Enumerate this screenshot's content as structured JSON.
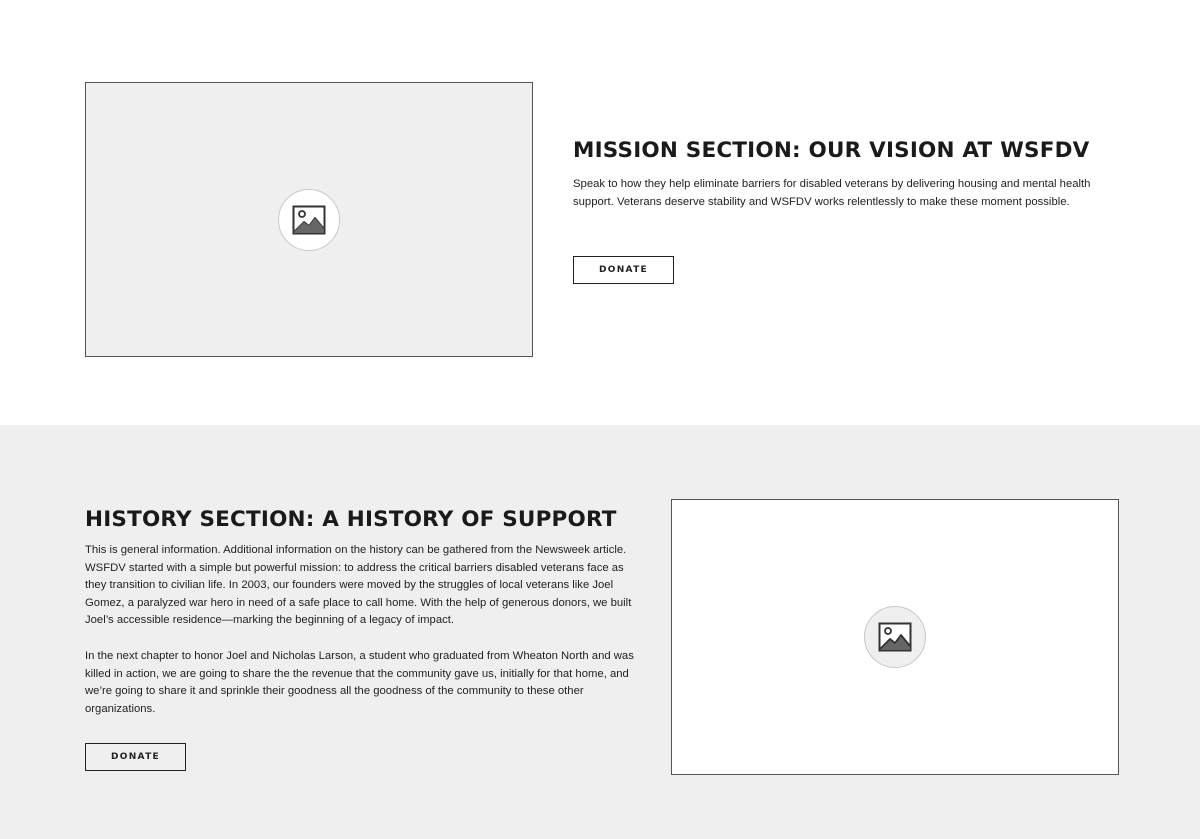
{
  "mission": {
    "heading": "MISSION SECTION: OUR VISION AT WSFDV",
    "body": "Speak to how they help eliminate barriers for disabled veterans by delivering housing and mental health support. Veterans deserve stability and WSFDV works relentlessly to make these moment possible.",
    "button_label": "DONATE",
    "image_icon": "image-icon"
  },
  "history": {
    "heading": "HISTORY SECTION: A HISTORY OF SUPPORT",
    "paragraph1": "This is general information. Additional information on the history can be gathered from the Newsweek article. WSFDV started with a simple but powerful mission: to address the critical barriers disabled veterans face as they transition to civilian life. In 2003, our founders were moved by the struggles of local veterans like Joel Gomez, a paralyzed war hero in need of a safe place to call home. With the help of generous donors, we built Joel’s accessible residence—marking the beginning of a legacy of impact.",
    "paragraph2": "In the next chapter to honor Joel and Nicholas Larson, a student who graduated from Wheaton North and was killed in action, we are going to share the the revenue that the community gave us, initially for that home, and we’re going to share it and sprinkle their goodness all the goodness of the community to these other organizations.",
    "button_label": "DONATE",
    "image_icon": "image-icon"
  },
  "colors": {
    "page_background": "#ffffff",
    "alt_section_background": "#efefef",
    "text": "#1a1a1a",
    "border": "#555555"
  }
}
